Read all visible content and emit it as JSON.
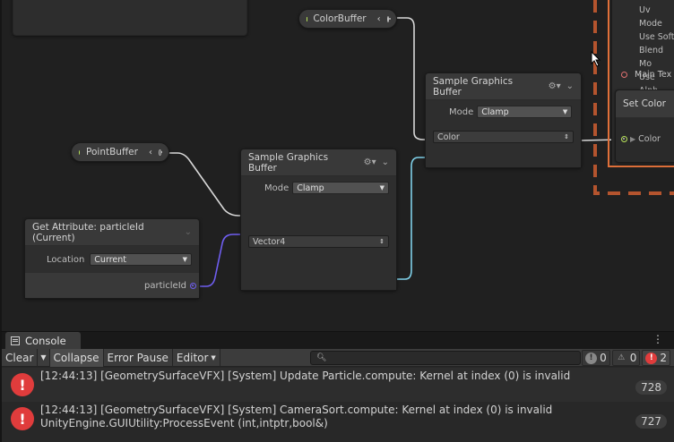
{
  "graph": {
    "colorbuffer_pill": {
      "label": "ColorBuffer"
    },
    "pointbuffer_pill": {
      "label": "PointBuffer"
    },
    "sample_top": {
      "title": "Sample Graphics Buffer",
      "mode_label": "Mode",
      "mode_value": "Clamp",
      "type_value": "Color"
    },
    "sample_mid": {
      "title": "Sample Graphics Buffer",
      "mode_label": "Mode",
      "mode_value": "Clamp",
      "type_value": "Vector4"
    },
    "get_attribute": {
      "title": "Get Attribute: particleId (Current)",
      "location_label": "Location",
      "location_value": "Current",
      "output_label": "particleId"
    },
    "output_context": {
      "items": [
        "Uv Mode",
        "Use Soft",
        "Blend Mo",
        "Use Alph"
      ],
      "main_texture_label": "Main Tex"
    },
    "set_color": {
      "title": "Set Color",
      "port_label": "Color"
    }
  },
  "console": {
    "tab_label": "Console",
    "toolbar": {
      "clear": "Clear",
      "collapse": "Collapse",
      "error_pause": "Error Pause",
      "editor": "Editor"
    },
    "search_placeholder": "",
    "counters": {
      "info": "0",
      "warnings": "0",
      "errors": "2"
    },
    "messages": [
      {
        "line1": "[12:44:13] [GeometrySurfaceVFX] [System] Update Particle.compute: Kernel at index (0) is invalid",
        "line2": "",
        "count": "728"
      },
      {
        "line1": "[12:44:13] [GeometrySurfaceVFX] [System] CameraSort.compute: Kernel at index (0) is invalid",
        "line2": "UnityEngine.GUIUtility:ProcessEvent (int,intptr,bool&)",
        "count": "727"
      }
    ]
  },
  "colors": {
    "wire_white": "#d8d8d8",
    "wire_blue": "#6f5ef0",
    "wire_cyan": "#7fd0e8",
    "context_orange": "#e0703a",
    "dashed_border": "#b4542e",
    "error_red": "#e03c3c"
  }
}
